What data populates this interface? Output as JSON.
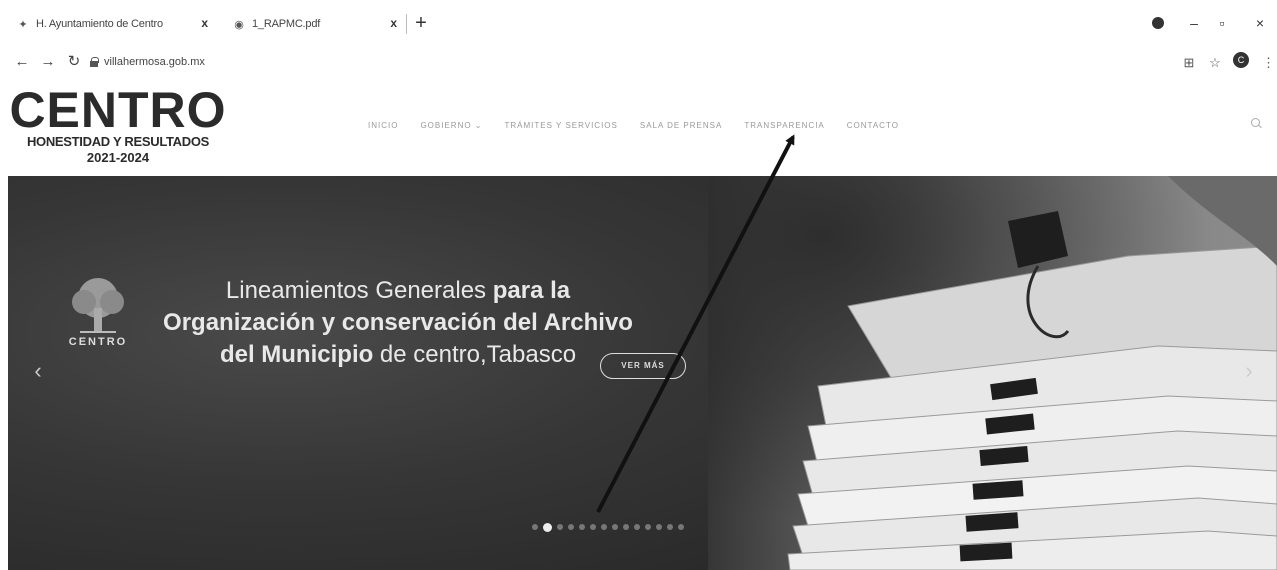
{
  "browser": {
    "tabs": [
      {
        "title": "H. Ayuntamiento de Centro",
        "close": "x"
      },
      {
        "title": "1_RAPMC.pdf",
        "close": "x"
      }
    ],
    "new_tab": "+",
    "url": "villahermosa.gob.mx",
    "profile_initial": "C",
    "window_controls": {
      "minimize": "–",
      "maximize": "▫",
      "close": "×"
    },
    "icons": [
      "back-icon",
      "forward-icon",
      "reload-icon",
      "lock-icon",
      "qr-icon",
      "star-icon",
      "menu-icon"
    ]
  },
  "site": {
    "logo": {
      "word": "CENTRO",
      "tagline": "HONESTIDAD Y RESULTADOS",
      "years": "2021-2024"
    },
    "menu": [
      {
        "label": "INICIO"
      },
      {
        "label": "GOBIERNO ⌄"
      },
      {
        "label": "TRÁMITES Y SERVICIOS"
      },
      {
        "label": "SALA DE PRENSA"
      },
      {
        "label": "TRANSPARENCIA"
      },
      {
        "label": "CONTACTO"
      }
    ]
  },
  "hero": {
    "seal_word": "CENTRO",
    "line1_regular": "Lineamientos Generales ",
    "line1_bold": "para la",
    "line2": "Organización y conservación del Archivo",
    "line3_bold": "del Municipio",
    "line3_regular": " de centro,Tabasco",
    "button": "VER MÁS",
    "prev": "‹",
    "next": "›",
    "slide_count": 14,
    "active_slide": 2
  },
  "annotation": {
    "type": "arrow",
    "points_to": "TRANSPARENCIA",
    "color": "#111111"
  }
}
